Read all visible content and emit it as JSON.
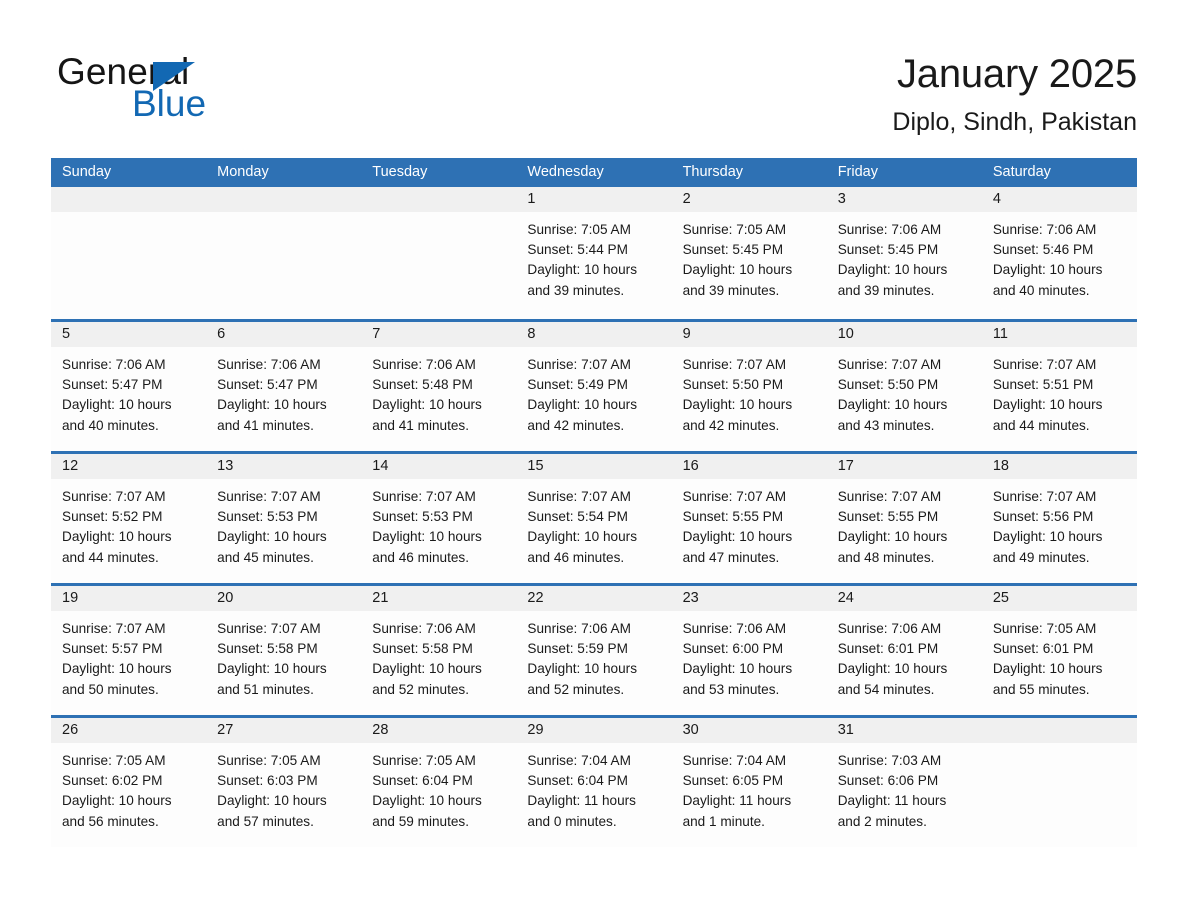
{
  "brand": {
    "name_part1": "General",
    "name_part2": "Blue",
    "flag_icon": "triangle-flag-icon",
    "accent_color": "#1268b3"
  },
  "header": {
    "title": "January 2025",
    "location": "Diplo, Sindh, Pakistan"
  },
  "theme": {
    "header_band": "#2e71b4",
    "day_band": "#f0f0f0",
    "cell_background": "#fdfdfd",
    "text": "#1a1a1a"
  },
  "weekdays": [
    "Sunday",
    "Monday",
    "Tuesday",
    "Wednesday",
    "Thursday",
    "Friday",
    "Saturday"
  ],
  "weeks": [
    [
      {
        "day": "",
        "sunrise": "",
        "sunset": "",
        "daylight_line1": "",
        "daylight_line2": ""
      },
      {
        "day": "",
        "sunrise": "",
        "sunset": "",
        "daylight_line1": "",
        "daylight_line2": ""
      },
      {
        "day": "",
        "sunrise": "",
        "sunset": "",
        "daylight_line1": "",
        "daylight_line2": ""
      },
      {
        "day": "1",
        "sunrise": "Sunrise: 7:05 AM",
        "sunset": "Sunset: 5:44 PM",
        "daylight_line1": "Daylight: 10 hours",
        "daylight_line2": "and 39 minutes."
      },
      {
        "day": "2",
        "sunrise": "Sunrise: 7:05 AM",
        "sunset": "Sunset: 5:45 PM",
        "daylight_line1": "Daylight: 10 hours",
        "daylight_line2": "and 39 minutes."
      },
      {
        "day": "3",
        "sunrise": "Sunrise: 7:06 AM",
        "sunset": "Sunset: 5:45 PM",
        "daylight_line1": "Daylight: 10 hours",
        "daylight_line2": "and 39 minutes."
      },
      {
        "day": "4",
        "sunrise": "Sunrise: 7:06 AM",
        "sunset": "Sunset: 5:46 PM",
        "daylight_line1": "Daylight: 10 hours",
        "daylight_line2": "and 40 minutes."
      }
    ],
    [
      {
        "day": "5",
        "sunrise": "Sunrise: 7:06 AM",
        "sunset": "Sunset: 5:47 PM",
        "daylight_line1": "Daylight: 10 hours",
        "daylight_line2": "and 40 minutes."
      },
      {
        "day": "6",
        "sunrise": "Sunrise: 7:06 AM",
        "sunset": "Sunset: 5:47 PM",
        "daylight_line1": "Daylight: 10 hours",
        "daylight_line2": "and 41 minutes."
      },
      {
        "day": "7",
        "sunrise": "Sunrise: 7:06 AM",
        "sunset": "Sunset: 5:48 PM",
        "daylight_line1": "Daylight: 10 hours",
        "daylight_line2": "and 41 minutes."
      },
      {
        "day": "8",
        "sunrise": "Sunrise: 7:07 AM",
        "sunset": "Sunset: 5:49 PM",
        "daylight_line1": "Daylight: 10 hours",
        "daylight_line2": "and 42 minutes."
      },
      {
        "day": "9",
        "sunrise": "Sunrise: 7:07 AM",
        "sunset": "Sunset: 5:50 PM",
        "daylight_line1": "Daylight: 10 hours",
        "daylight_line2": "and 42 minutes."
      },
      {
        "day": "10",
        "sunrise": "Sunrise: 7:07 AM",
        "sunset": "Sunset: 5:50 PM",
        "daylight_line1": "Daylight: 10 hours",
        "daylight_line2": "and 43 minutes."
      },
      {
        "day": "11",
        "sunrise": "Sunrise: 7:07 AM",
        "sunset": "Sunset: 5:51 PM",
        "daylight_line1": "Daylight: 10 hours",
        "daylight_line2": "and 44 minutes."
      }
    ],
    [
      {
        "day": "12",
        "sunrise": "Sunrise: 7:07 AM",
        "sunset": "Sunset: 5:52 PM",
        "daylight_line1": "Daylight: 10 hours",
        "daylight_line2": "and 44 minutes."
      },
      {
        "day": "13",
        "sunrise": "Sunrise: 7:07 AM",
        "sunset": "Sunset: 5:53 PM",
        "daylight_line1": "Daylight: 10 hours",
        "daylight_line2": "and 45 minutes."
      },
      {
        "day": "14",
        "sunrise": "Sunrise: 7:07 AM",
        "sunset": "Sunset: 5:53 PM",
        "daylight_line1": "Daylight: 10 hours",
        "daylight_line2": "and 46 minutes."
      },
      {
        "day": "15",
        "sunrise": "Sunrise: 7:07 AM",
        "sunset": "Sunset: 5:54 PM",
        "daylight_line1": "Daylight: 10 hours",
        "daylight_line2": "and 46 minutes."
      },
      {
        "day": "16",
        "sunrise": "Sunrise: 7:07 AM",
        "sunset": "Sunset: 5:55 PM",
        "daylight_line1": "Daylight: 10 hours",
        "daylight_line2": "and 47 minutes."
      },
      {
        "day": "17",
        "sunrise": "Sunrise: 7:07 AM",
        "sunset": "Sunset: 5:55 PM",
        "daylight_line1": "Daylight: 10 hours",
        "daylight_line2": "and 48 minutes."
      },
      {
        "day": "18",
        "sunrise": "Sunrise: 7:07 AM",
        "sunset": "Sunset: 5:56 PM",
        "daylight_line1": "Daylight: 10 hours",
        "daylight_line2": "and 49 minutes."
      }
    ],
    [
      {
        "day": "19",
        "sunrise": "Sunrise: 7:07 AM",
        "sunset": "Sunset: 5:57 PM",
        "daylight_line1": "Daylight: 10 hours",
        "daylight_line2": "and 50 minutes."
      },
      {
        "day": "20",
        "sunrise": "Sunrise: 7:07 AM",
        "sunset": "Sunset: 5:58 PM",
        "daylight_line1": "Daylight: 10 hours",
        "daylight_line2": "and 51 minutes."
      },
      {
        "day": "21",
        "sunrise": "Sunrise: 7:06 AM",
        "sunset": "Sunset: 5:58 PM",
        "daylight_line1": "Daylight: 10 hours",
        "daylight_line2": "and 52 minutes."
      },
      {
        "day": "22",
        "sunrise": "Sunrise: 7:06 AM",
        "sunset": "Sunset: 5:59 PM",
        "daylight_line1": "Daylight: 10 hours",
        "daylight_line2": "and 52 minutes."
      },
      {
        "day": "23",
        "sunrise": "Sunrise: 7:06 AM",
        "sunset": "Sunset: 6:00 PM",
        "daylight_line1": "Daylight: 10 hours",
        "daylight_line2": "and 53 minutes."
      },
      {
        "day": "24",
        "sunrise": "Sunrise: 7:06 AM",
        "sunset": "Sunset: 6:01 PM",
        "daylight_line1": "Daylight: 10 hours",
        "daylight_line2": "and 54 minutes."
      },
      {
        "day": "25",
        "sunrise": "Sunrise: 7:05 AM",
        "sunset": "Sunset: 6:01 PM",
        "daylight_line1": "Daylight: 10 hours",
        "daylight_line2": "and 55 minutes."
      }
    ],
    [
      {
        "day": "26",
        "sunrise": "Sunrise: 7:05 AM",
        "sunset": "Sunset: 6:02 PM",
        "daylight_line1": "Daylight: 10 hours",
        "daylight_line2": "and 56 minutes."
      },
      {
        "day": "27",
        "sunrise": "Sunrise: 7:05 AM",
        "sunset": "Sunset: 6:03 PM",
        "daylight_line1": "Daylight: 10 hours",
        "daylight_line2": "and 57 minutes."
      },
      {
        "day": "28",
        "sunrise": "Sunrise: 7:05 AM",
        "sunset": "Sunset: 6:04 PM",
        "daylight_line1": "Daylight: 10 hours",
        "daylight_line2": "and 59 minutes."
      },
      {
        "day": "29",
        "sunrise": "Sunrise: 7:04 AM",
        "sunset": "Sunset: 6:04 PM",
        "daylight_line1": "Daylight: 11 hours",
        "daylight_line2": "and 0 minutes."
      },
      {
        "day": "30",
        "sunrise": "Sunrise: 7:04 AM",
        "sunset": "Sunset: 6:05 PM",
        "daylight_line1": "Daylight: 11 hours",
        "daylight_line2": "and 1 minute."
      },
      {
        "day": "31",
        "sunrise": "Sunrise: 7:03 AM",
        "sunset": "Sunset: 6:06 PM",
        "daylight_line1": "Daylight: 11 hours",
        "daylight_line2": "and 2 minutes."
      },
      {
        "day": "",
        "sunrise": "",
        "sunset": "",
        "daylight_line1": "",
        "daylight_line2": ""
      }
    ]
  ]
}
